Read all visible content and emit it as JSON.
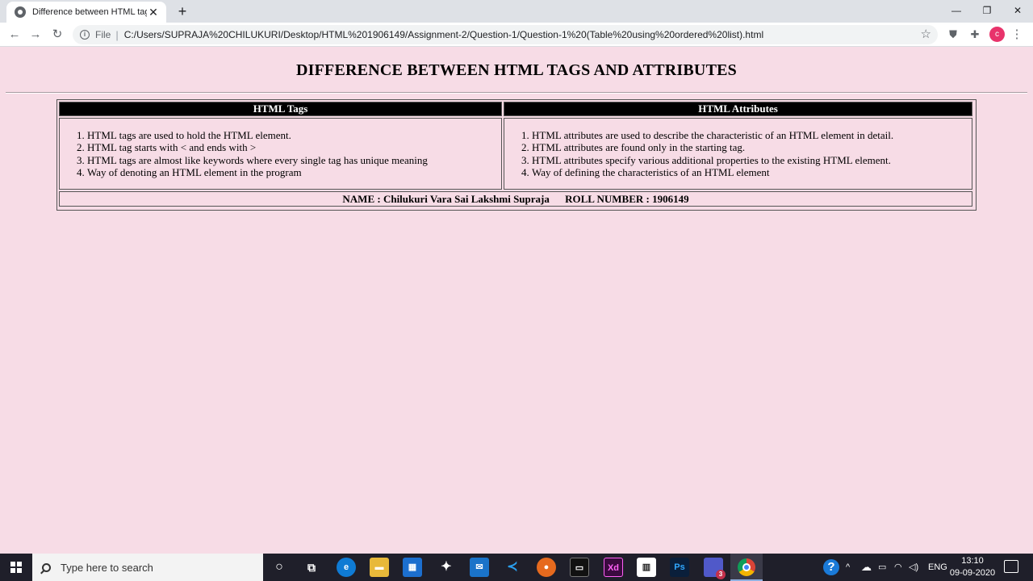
{
  "browser": {
    "tab_title": "Difference between HTML tags a",
    "new_tab_symbol": "+",
    "close_symbol": "✕",
    "file_label": "File",
    "url": "C:/Users/SUPRAJA%20CHILUKURI/Desktop/HTML%201906149/Assignment-2/Question-1/Question-1%20(Table%20using%20ordered%20list).html",
    "profile_initial": "c",
    "profile_color": "#e8336b"
  },
  "page": {
    "heading": "DIFFERENCE BETWEEN HTML TAGS AND ATTRIBUTES",
    "table": {
      "headers": [
        "HTML Tags",
        "HTML Attributes"
      ],
      "tags_list": [
        "HTML tags are used to hold the HTML element.",
        "HTML tag starts with < and ends with >",
        "HTML tags are almost like keywords where every single tag has unique meaning",
        "Way of denoting an HTML element in the program"
      ],
      "attributes_list": [
        "HTML attributes are used to describe the characteristic of an HTML element in detail.",
        "HTML attributes are found only in the starting tag.",
        "HTML attributes specify various additional properties to the existing HTML element.",
        "Way of defining the characteristics of an HTML element"
      ],
      "footer_name": "NAME : Chilukuri Vara Sai Lakshmi Supraja",
      "footer_roll": "ROLL NUMBER : 1906149"
    },
    "background_color": "#f7dce6"
  },
  "taskbar": {
    "search_placeholder": "Type here to search",
    "time": "13:10",
    "date": "09-09-2020",
    "language": "ENG",
    "teams_badge": "3",
    "xd_label": "Xd",
    "ps_label": "Ps"
  }
}
